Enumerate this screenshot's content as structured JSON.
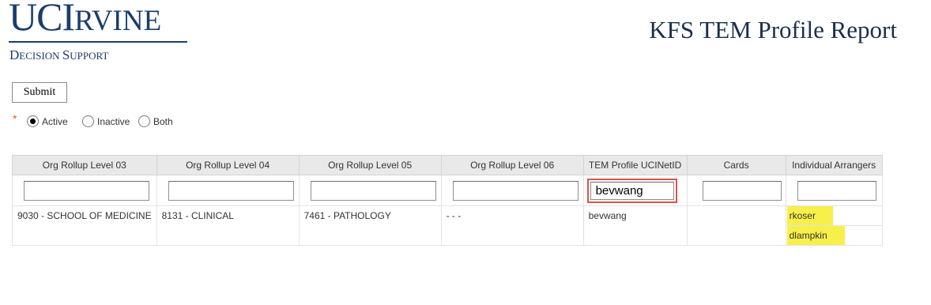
{
  "logo": {
    "uc": "UC",
    "i": "I",
    "rvine": "RVINE",
    "d": "D",
    "ecision": "ECISION ",
    "s": "S",
    "upport": "UPPORT"
  },
  "report_title": "KFS TEM Profile Report",
  "submit_label": "Submit",
  "required_marker": "*",
  "status_options": [
    {
      "label": "Active",
      "selected": true
    },
    {
      "label": "Inactive",
      "selected": false
    },
    {
      "label": "Both",
      "selected": false
    }
  ],
  "table": {
    "columns": [
      "Org Rollup Level 03",
      "Org Rollup Level 04",
      "Org Rollup Level 05",
      "Org Rollup Level 06",
      "TEM Profile UCINetID",
      "Cards",
      "Individual Arrangers"
    ],
    "filters": [
      "",
      "",
      "",
      "",
      "bevwang",
      "",
      ""
    ],
    "rows": [
      {
        "org03": "9030 - SCHOOL OF MEDICINE",
        "org04": "8131 - CLINICAL",
        "org05": "7461 - PATHOLOGY",
        "org06": "- - -",
        "ucinetid": "bevwang",
        "cards": "",
        "arrangers": [
          "rkoser",
          "dlampkin"
        ]
      }
    ]
  },
  "colors": {
    "brand": "#1b3d6d",
    "required": "#e8610b",
    "highlight_border": "#d9534f",
    "highlight_fill": "#f7f04a"
  }
}
